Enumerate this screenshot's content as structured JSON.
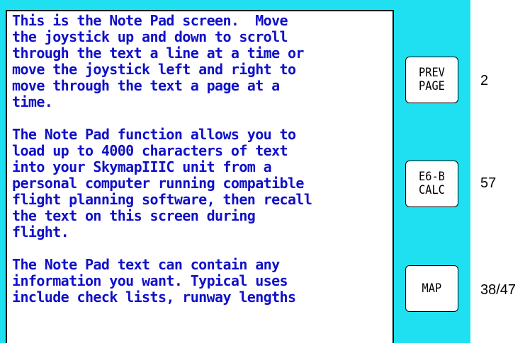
{
  "screen": {
    "colors": {
      "background": "#1ee0f0",
      "text": "#1010c8",
      "panel": "#ffffff"
    }
  },
  "notepad": {
    "lines": [
      "This is the Note Pad screen.  Move",
      "the joystick up and down to scroll",
      "through the text a line at a time or",
      "move the joystick left and right to",
      "move through the text a page at a",
      "time.",
      "",
      "The Note Pad function allows you to",
      "load up to 4000 characters of text",
      "into your SkymapIIIC unit from a",
      "personal computer running compatible",
      "flight planning software, then recall",
      "the text on this screen during",
      "flight.",
      "",
      "The Note Pad text can contain any",
      "information you want. Typical uses",
      "include check lists, runway lengths"
    ]
  },
  "softkeys": {
    "prev_page": {
      "line1": "PREV",
      "line2": "PAGE"
    },
    "e6b_calc": {
      "line1": "E6-B",
      "line2": "CALC"
    },
    "map": {
      "line1": "MAP"
    }
  },
  "annotations": {
    "prev_page": "2",
    "e6b_calc": "57",
    "map": "38/47"
  }
}
